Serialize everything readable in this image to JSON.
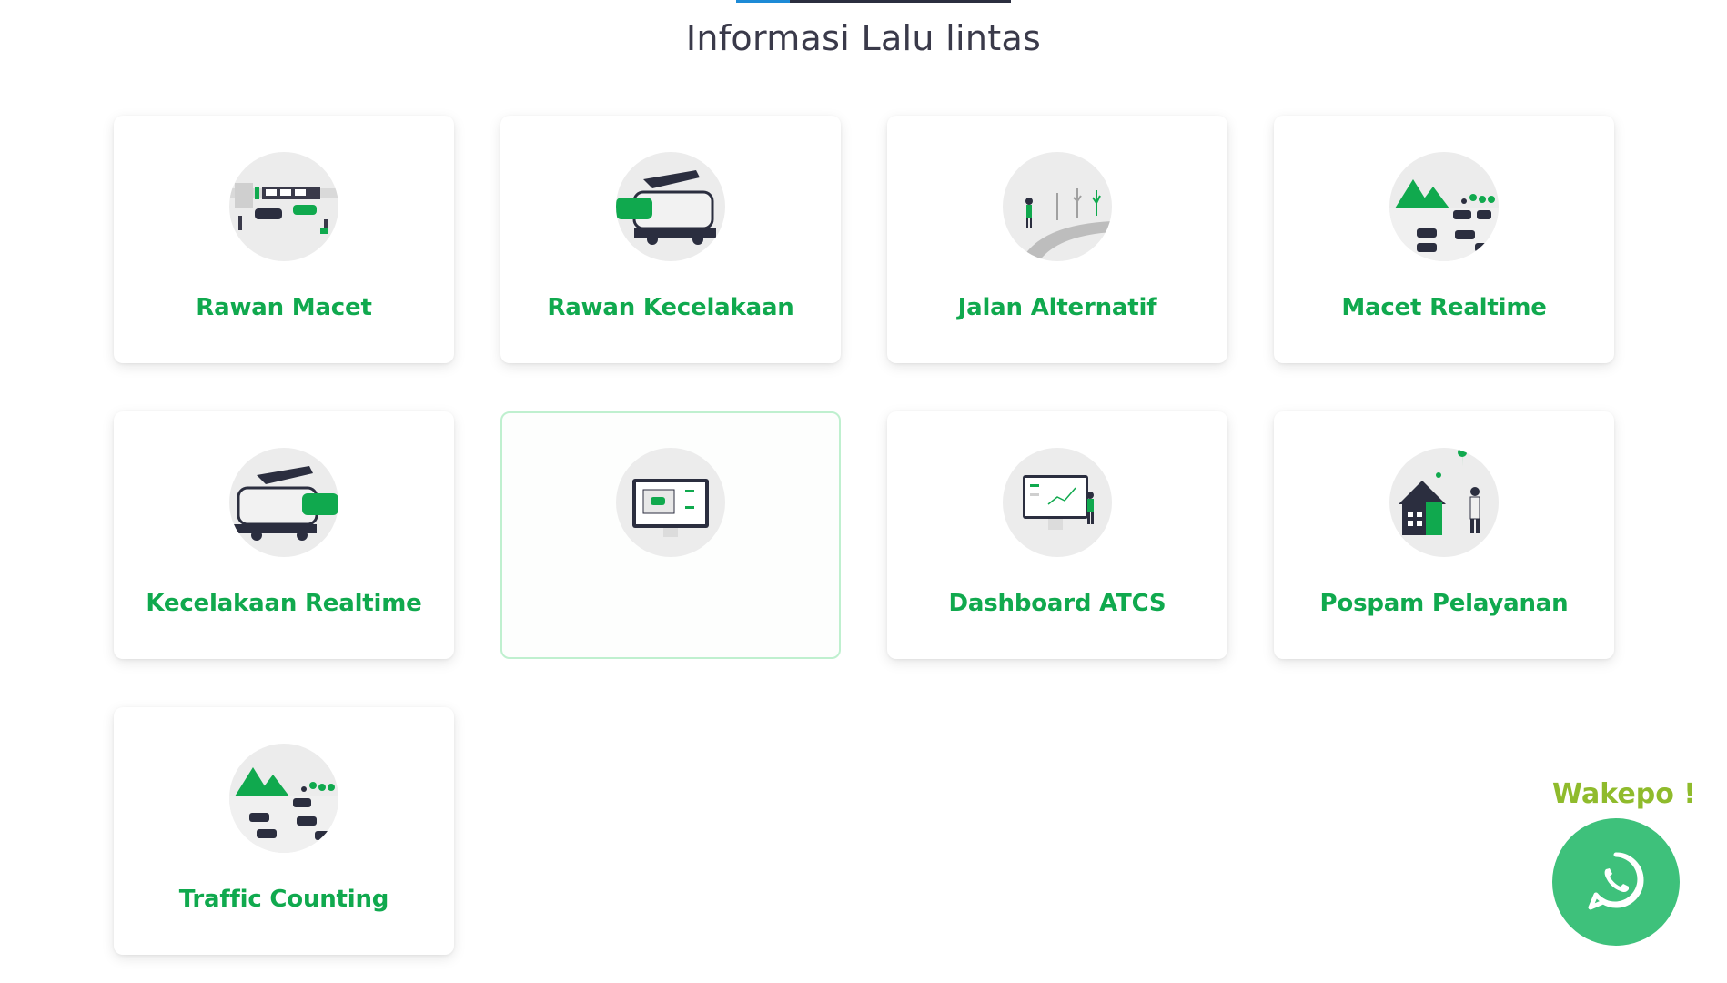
{
  "section": {
    "title": "Informasi Lalu lintas"
  },
  "cards": [
    {
      "label": "Rawan Macet"
    },
    {
      "label": "Rawan Kecelakaan"
    },
    {
      "label": "Jalan Alternatif"
    },
    {
      "label": "Macet Realtime"
    },
    {
      "label": "Kecelakaan Realtime"
    },
    {
      "label": ""
    },
    {
      "label": "Dashboard ATCS"
    },
    {
      "label": "Pospam Pelayanan"
    },
    {
      "label": "Traffic Counting"
    }
  ],
  "whatsapp": {
    "label": "Wakepo !",
    "icon": "whatsapp-icon"
  },
  "colors": {
    "accent": "#10a94e",
    "whatsapp": "#3ec17b",
    "wakepo": "#8fbb2c"
  }
}
